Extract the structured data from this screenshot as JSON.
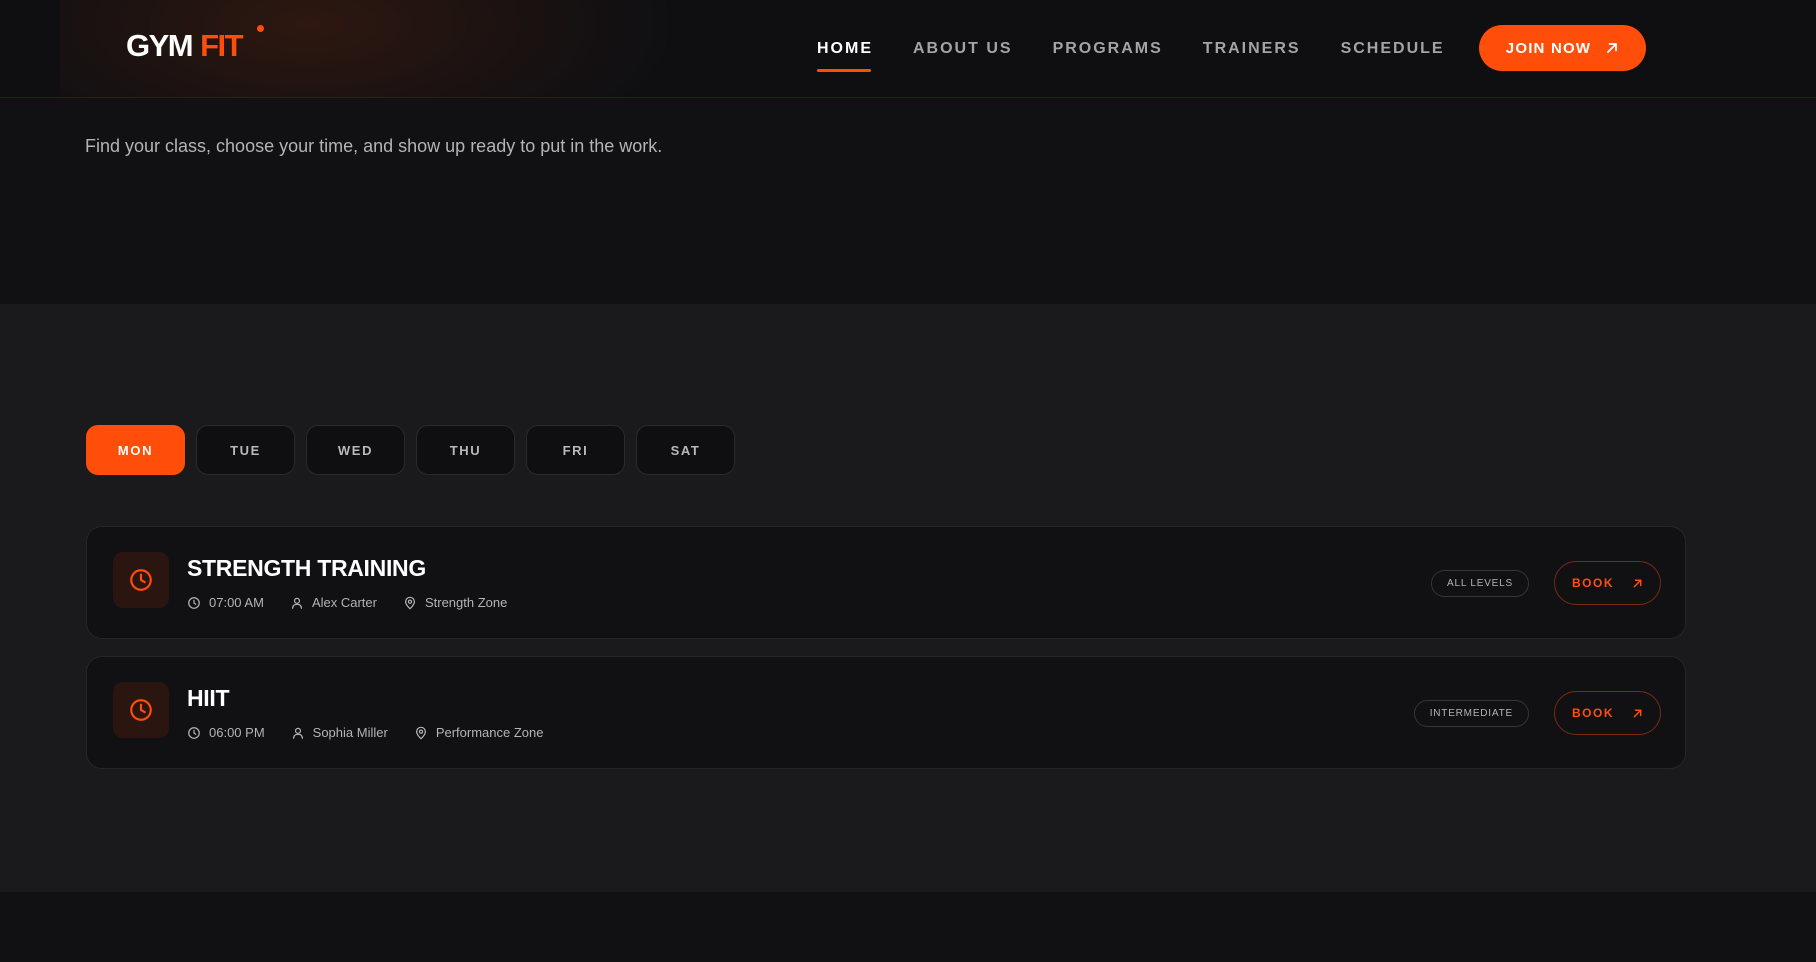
{
  "header": {
    "logo_primary": "GYM",
    "logo_accent": "FIT",
    "nav": [
      {
        "label": "HOME",
        "active": true
      },
      {
        "label": "ABOUT US",
        "active": false
      },
      {
        "label": "PROGRAMS",
        "active": false
      },
      {
        "label": "TRAINERS",
        "active": false
      },
      {
        "label": "SCHEDULE",
        "active": false
      }
    ],
    "cta_label": "JOIN NOW",
    "cta_icon": "arrow-up-right-icon"
  },
  "hero": {
    "subtitle": "Find your class, choose your time, and show up ready to put in the work."
  },
  "schedule": {
    "days": [
      {
        "label": "MON",
        "active": true
      },
      {
        "label": "TUE",
        "active": false
      },
      {
        "label": "WED",
        "active": false
      },
      {
        "label": "THU",
        "active": false
      },
      {
        "label": "FRI",
        "active": false
      },
      {
        "label": "SAT",
        "active": false
      }
    ],
    "classes": [
      {
        "title": "STRENGTH TRAINING",
        "time": "07:00 AM",
        "trainer": "Alex Carter",
        "location": "Strength Zone",
        "level": "ALL LEVELS",
        "book_label": "BOOK"
      },
      {
        "title": "HIIT",
        "time": "06:00 PM",
        "trainer": "Sophia Miller",
        "location": "Performance Zone",
        "level": "INTERMEDIATE",
        "book_label": "BOOK"
      }
    ]
  },
  "colors": {
    "accent": "#ff4d0a",
    "background": "#111114",
    "section_background": "#1a1a1d",
    "card_background": "#111114",
    "muted_text": "#b3b3b8"
  }
}
